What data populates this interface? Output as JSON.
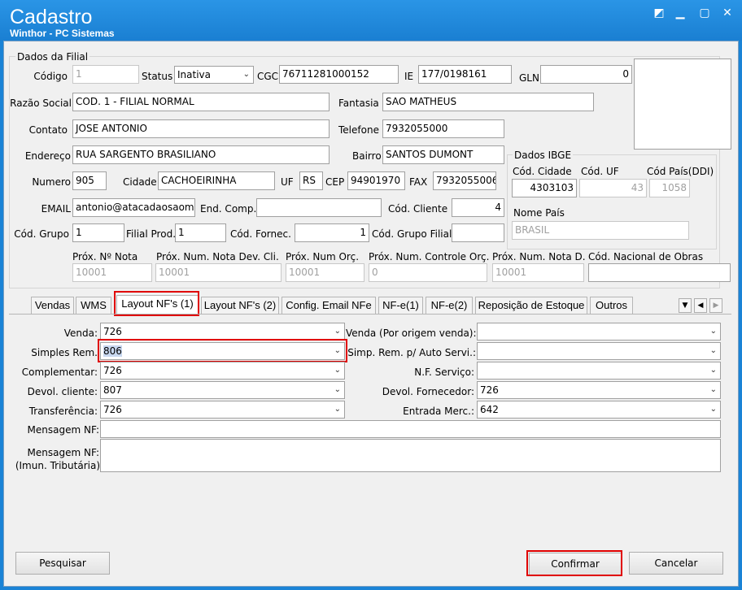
{
  "window": {
    "title": "Cadastro",
    "subtitle": "Winthor - PC Sistemas",
    "btn_restore": "◩",
    "btn_min": "▁",
    "btn_max": "▢",
    "btn_close": "✕"
  },
  "filial": {
    "group_label": "Dados da Filial",
    "codigo_label": "Código",
    "codigo": "1",
    "status_label": "Status",
    "status": "Inativa",
    "cgc_label": "CGC",
    "cgc": "76711281000152",
    "ie_label": "IE",
    "ie": "177/0198161",
    "gln_label": "GLN",
    "gln": "0",
    "razao_label": "Razão Social",
    "razao": "COD. 1 - FILIAL NORMAL",
    "fantasia_label": "Fantasia",
    "fantasia": "SAO MATHEUS",
    "contato_label": "Contato",
    "contato": "JOSE ANTONIO",
    "telefone_label": "Telefone",
    "telefone": "7932055000",
    "endereco_label": "Endereço",
    "endereco": "RUA SARGENTO BRASILIANO",
    "bairro_label": "Bairro",
    "bairro": "SANTOS DUMONT",
    "numero_label": "Numero",
    "numero": "905",
    "cidade_label": "Cidade",
    "cidade": "CACHOEIRINHA",
    "uf_label": "UF",
    "uf": "RS",
    "cep_label": "CEP",
    "cep": "94901970",
    "fax_label": "FAX",
    "fax": "7932055006",
    "email_label": "EMAIL",
    "email": "antonio@atacadaosaomat",
    "endcomp_label": "End. Comp.",
    "endcomp": "",
    "codcliente_label": "Cód. Cliente",
    "codcliente": "4",
    "codgrupo_label": "Cód. Grupo",
    "codgrupo": "1",
    "filialprod_label": "Filial Prod.",
    "filialprod": "1",
    "codfornec_label": "Cód. Fornec.",
    "codfornec": "1",
    "codgrupofilial_label": "Cód. Grupo Filial",
    "codgrupofilial": ""
  },
  "ibge": {
    "group_label": "Dados IBGE",
    "codcidade_label": "Cód. Cidade",
    "codcidade": "4303103",
    "coduf_label": "Cód. UF",
    "coduf": "43",
    "codpais_label": "Cód País(DDI)",
    "codpais": "1058",
    "nomepais_label": "Nome País",
    "nomepais": "BRASIL"
  },
  "prox": {
    "nf_label": "Próx. Nº Nota",
    "nf": "10001",
    "dev_label": "Próx. Num. Nota Dev. Cli.",
    "dev": "10001",
    "orc_label": "Próx. Num Orç.",
    "orc": "10001",
    "ctrl_label": "Próx. Num. Controle Orç.",
    "ctrl": "0",
    "notad_label": "Próx. Num. Nota D.",
    "notad": "10001",
    "obras_label": "Cód. Nacional de Obras",
    "obras": ""
  },
  "tabs": [
    "Vendas",
    "WMS",
    "Layout NF's (1)",
    "Layout NF's (2)",
    "Config. Email NFe",
    "NF-e(1)",
    "NF-e(2)",
    "Reposição de Estoque",
    "Outros"
  ],
  "nav": {
    "down": "▼",
    "left": "◀",
    "right": "▶"
  },
  "layout": {
    "venda_label": "Venda:",
    "venda": "726",
    "simples_label": "Simples Rem.",
    "simples": "806",
    "complementar_label": "Complementar:",
    "complementar": "726",
    "devcliente_label": "Devol. cliente:",
    "devcliente": "807",
    "transferencia_label": "Transferência:",
    "transferencia": "726",
    "vendaorigem_label": "Venda (Por origem venda):",
    "vendaorigem": "",
    "simpauto_label": "Simp. Rem. p/ Auto Servi.:",
    "simpauto": "",
    "nfservico_label": "N.F. Serviço:",
    "nfservico": "",
    "devfornec_label": "Devol. Fornecedor:",
    "devfornec": "726",
    "entrada_label": "Entrada Merc.:",
    "entrada": "642",
    "mensagem_label": "Mensagem NF:",
    "mensagem_imun_label1": "Mensagem NF:",
    "mensagem_imun_label2": "(Imun. Tributária)"
  },
  "buttons": {
    "pesquisar": "Pesquisar",
    "confirmar": "Confirmar",
    "cancelar": "Cancelar"
  },
  "arrow": "⌄",
  "colors": {
    "titlebar": "#1a83d6",
    "highlight": "#e00000"
  }
}
